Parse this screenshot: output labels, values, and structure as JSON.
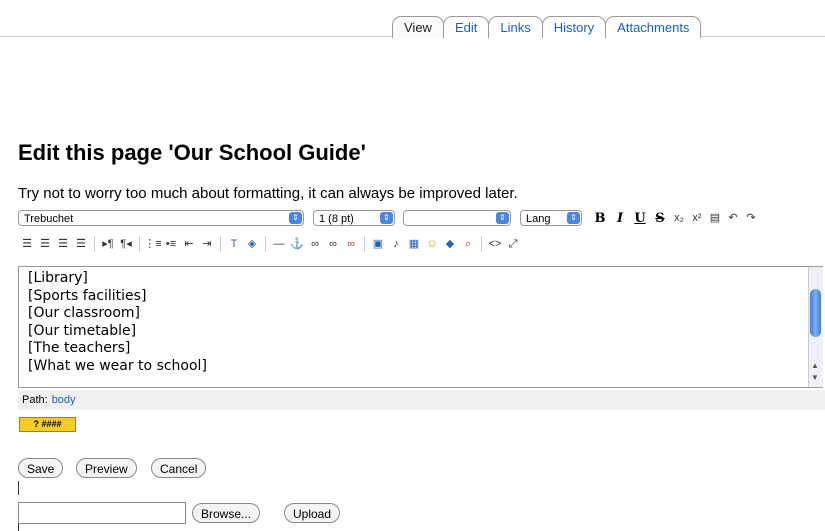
{
  "tabs": [
    {
      "label": "View",
      "active": true
    },
    {
      "label": "Edit"
    },
    {
      "label": "Links"
    },
    {
      "label": "History"
    },
    {
      "label": "Attachments"
    }
  ],
  "page_title": "Edit this page 'Our School Guide'",
  "hint": "Try not to worry too much about formatting, it can always be improved later.",
  "toolbar": {
    "font_family": "Trebuchet",
    "font_size": "1 (8 pt)",
    "format": "",
    "lang": "Lang",
    "bold": "B",
    "italic": "I",
    "underline": "U",
    "strike": "S"
  },
  "editor_lines": [
    "[Library]",
    "[Sports facilities]",
    "[Our classroom]",
    "[Our timetable]",
    "[The teachers]",
    "[What we wear to school]"
  ],
  "path": {
    "label": "Path:",
    "value": "body"
  },
  "help_label": "? ####",
  "buttons": {
    "save": "Save",
    "preview": "Preview",
    "cancel": "Cancel",
    "browse": "Browse...",
    "upload": "Upload"
  },
  "file_input_value": ""
}
